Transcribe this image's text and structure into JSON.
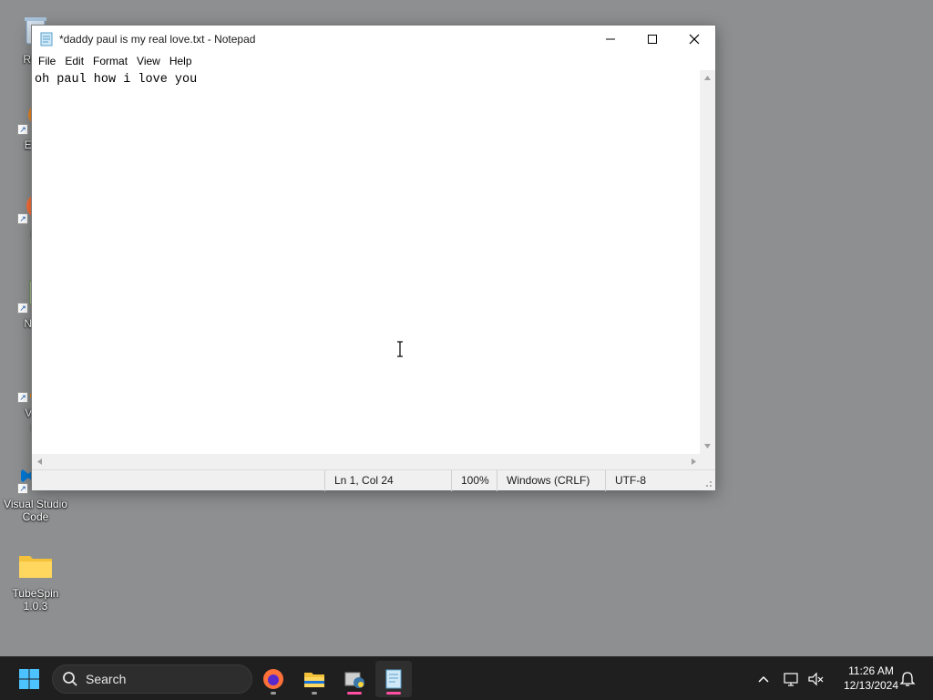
{
  "desktop": {
    "icons": [
      {
        "label": "Recy"
      },
      {
        "label": "Ever"
      },
      {
        "label": "Fi"
      },
      {
        "label": "Note"
      },
      {
        "label": "VLC\npl"
      },
      {
        "label": "Visual Studio\nCode"
      },
      {
        "label": "TubeSpin\n1.0.3"
      }
    ]
  },
  "notepad": {
    "title": "*daddy paul is my real love.txt - Notepad",
    "menu": [
      "File",
      "Edit",
      "Format",
      "View",
      "Help"
    ],
    "content": "oh paul how i love you",
    "status": {
      "position": "Ln 1, Col 24",
      "zoom": "100%",
      "line_ending": "Windows (CRLF)",
      "encoding": "UTF-8"
    }
  },
  "taskbar": {
    "search_label": "Search",
    "pinned": [
      {
        "icon": "firefox-icon"
      },
      {
        "icon": "file-explorer-icon"
      },
      {
        "icon": "python-installer-icon"
      },
      {
        "icon": "notepad-icon"
      }
    ],
    "clock": {
      "time": "11:26 AM",
      "date": "12/13/2024"
    }
  },
  "colors": {
    "taskbar": "#1f1f1f",
    "accent": "#0078d4",
    "indicator_pink": "#ff4fa3",
    "indicator_gray": "#9a9a9a"
  }
}
